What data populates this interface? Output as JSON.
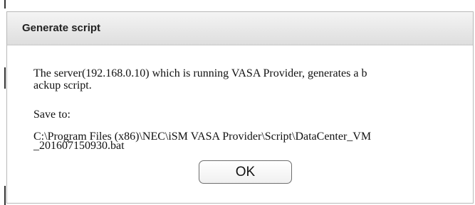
{
  "dialog": {
    "title": "Generate script",
    "message_line1": "The server(192.168.0.10) which is running VASA Provider, generates a b",
    "message_line2": "ackup script.",
    "save_label": "Save to:",
    "path_line1": "C:\\Program Files (x86)\\NEC\\iSM VASA Provider\\Script\\DataCenter_VM",
    "path_line2": "_201607150930.bat",
    "ok_label": "OK"
  }
}
